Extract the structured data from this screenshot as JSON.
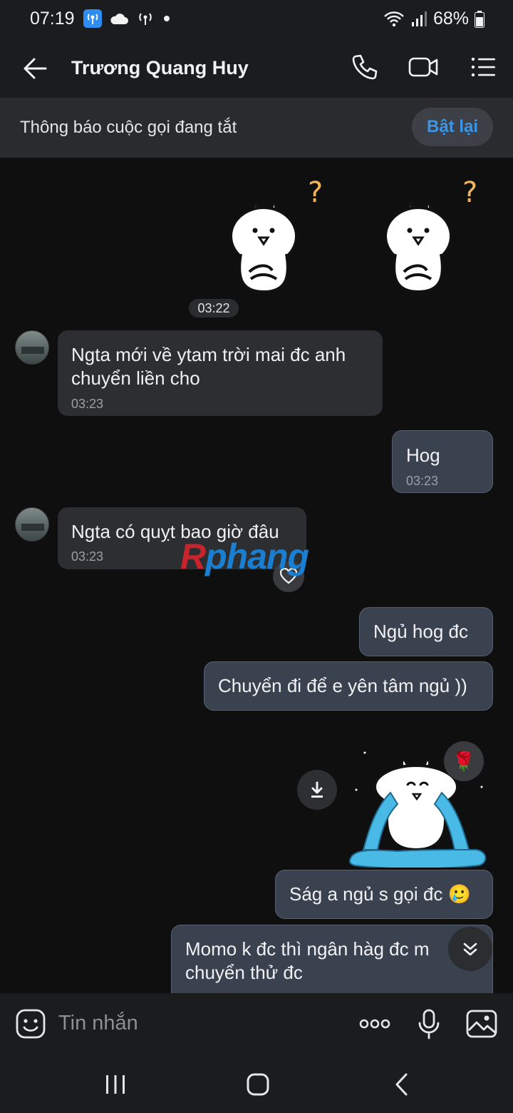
{
  "status_bar": {
    "time": "07:19",
    "battery": "68%"
  },
  "header": {
    "contact_name": "Trương Quang Huy"
  },
  "notice": {
    "text": "Thông báo cuộc gọi đang tắt",
    "button_label": "Bật lại"
  },
  "chat": {
    "sticker_time": "03:22",
    "messages": [
      {
        "direction": "incoming",
        "text": "Ngta mới về ytam trời mai đc anh\nchuyển liền cho",
        "time": "03:23"
      },
      {
        "direction": "outgoing",
        "text": "Hog",
        "time": "03:23"
      },
      {
        "direction": "incoming",
        "text": "Ngta có quỵt bao giờ đâu",
        "time": "03:23"
      },
      {
        "direction": "outgoing",
        "text": "Ngủ hog đc"
      },
      {
        "direction": "outgoing",
        "text": "Chuyển đi để e yên tâm ngủ ))"
      },
      {
        "direction": "outgoing",
        "text": "Ság a ngủ s gọi đc 🥲"
      },
      {
        "direction": "outgoing",
        "text": "Momo k đc thì ngân hàg đc m\nchuyển thử đc"
      }
    ],
    "rose_reaction": "🌹"
  },
  "watermark": {
    "part1": "R",
    "part2": "phang"
  },
  "input": {
    "placeholder": "Tin nhắn"
  },
  "colors": {
    "accent": "#3b95ea",
    "outgoing_bubble": "#3a4250",
    "incoming_bubble": "#2d2e31"
  }
}
